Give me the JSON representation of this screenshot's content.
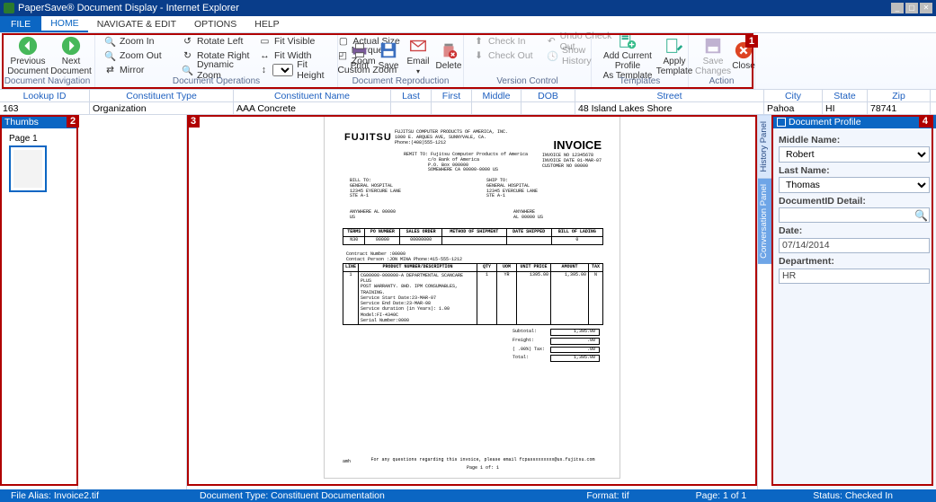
{
  "title": "PaperSave® Document Display - Internet Explorer",
  "tabs": {
    "file": "FILE",
    "home": "HOME",
    "navigate": "NAVIGATE & EDIT",
    "options": "OPTIONS",
    "help": "HELP"
  },
  "ribbon": {
    "navigation": {
      "label": "Document Navigation",
      "prev": "Previous\nDocument",
      "next": "Next Document"
    },
    "operations": {
      "label": "Document Operations",
      "zoom_in": "Zoom In",
      "zoom_out": "Zoom Out",
      "mirror": "Mirror",
      "rotate_left": "Rotate Left",
      "rotate_right": "Rotate Right",
      "dynamic_zoom": "Dynamic Zoom",
      "fit_visible": "Fit Visible",
      "fit_width": "Fit Width",
      "fit_height": "Fit Height",
      "actual_size": "Actual Size",
      "marquee_zoom": "Marquee Zoom",
      "custom_zoom": "Custom Zoom"
    },
    "reproduction": {
      "label": "Document Reproduction",
      "print": "Print",
      "save": "Save",
      "email": "Email",
      "delete": "Delete"
    },
    "version": {
      "label": "Version Control",
      "check_in": "Check In",
      "check_out": "Check Out",
      "undo_check_out": "Undo Check Out",
      "show_history": "Show History"
    },
    "templates": {
      "label": "Templates",
      "add_current": "Add Current Profile\nAs Template",
      "apply": "Apply\nTemplate"
    },
    "action": {
      "label": "Action",
      "save_changes": "Save\nChanges",
      "close": "Close"
    }
  },
  "callouts": {
    "c1": "1",
    "c2": "2",
    "c3": "3",
    "c4": "4"
  },
  "fields_header": {
    "lookup": "Lookup ID",
    "ctype": "Constituent Type",
    "cname": "Constituent Name",
    "last": "Last",
    "first": "First",
    "middle": "Middle",
    "dob": "DOB",
    "street": "Street",
    "city": "City",
    "state": "State",
    "zip": "Zip"
  },
  "fields_values": {
    "lookup": "163",
    "ctype": "Organization",
    "cname": "AAA Concrete",
    "last": "",
    "first": "",
    "middle": "",
    "dob": "",
    "street": "48 Island Lakes Shore",
    "city": "Pahoa",
    "state": "HI",
    "zip": "78741"
  },
  "thumbs": {
    "header": "Thumbs",
    "page1": "Page 1"
  },
  "doc": {
    "logo": "FUJITSU",
    "addr_l1": "FUJITSU COMPUTER PRODUCTS OF AMERICA, INC.",
    "addr_l2": "1000 E. ARQUES AVE, SUNNYVALE, CA.",
    "addr_l3": "Phone:(408)555-1212",
    "inv_title": "INVOICE",
    "inv_no_lbl": "INVOICE NO",
    "inv_no": "12345678",
    "inv_date_lbl": "INVOICE DATE",
    "inv_date": "01-MAR-07",
    "cust_no_lbl": "CUSTOMER NO",
    "cust_no": "00000",
    "remit_lbl": "REMIT TO:",
    "remit_l1": "Fujitsu Computer Products of America",
    "remit_l2": "c/o Bank of America",
    "remit_l3": "P.O. Box 000000",
    "remit_l4": "SOMEWHERE CA 00000-0000 US",
    "billto_lbl": "BILL TO:",
    "shipto_lbl": "SHIP TO:",
    "hosp": "GENERAL HOSPITAL",
    "addr_line": "12345 EYERCURE LANE",
    "ste": "STE A-1",
    "anywh_al": "ANYWHERE AL 00000",
    "us": "US",
    "anywh": "ANYWHERE",
    "al_us": "AL 00000 US",
    "t1": {
      "h_terms": "TERMS",
      "h_po": "PO NUMBER",
      "h_so": "SALES ORDER",
      "h_ship": "METHOD OF SHIPMENT",
      "h_date": "DATE SHIPPED",
      "h_bol": "BILL OF LADING",
      "v_terms": "N30",
      "v_po": "00000",
      "v_so": "00000000",
      "v_ship": "",
      "v_date": "",
      "v_bol": "0"
    },
    "contract_no": "Contract Number :00000",
    "contract_person": "Contact Person :JON MINA   Phone:415-555-1212",
    "t2": {
      "h_line": "LINE",
      "h_desc": "PRODUCT NUMBER/DESCRIPTION",
      "h_qty": "QTY",
      "h_uom": "UOM",
      "h_unit": "UNIT PRICE",
      "h_amt": "AMOUNT",
      "h_tax": "TAX",
      "line": "1",
      "desc": "CG00000-000000-A DEPARTMENTAL SCANCARE PLUS\nPOST WARRANTY. 8HD. IPM CONSUMABLES, TRAINING.\nService Start Date:23-MAR-07\nService End Date:23-MAR-08\nService duration (in Years): 1.00\nModel:FI-4340C\nSerial Number:0000",
      "qty": "1",
      "uom": "YR",
      "unit": "1395.00",
      "amt": "1,395.00",
      "tax": "N"
    },
    "tot": {
      "subtotal_lbl": "Subtotal:",
      "subtotal": "1,395.00",
      "freight_lbl": "Freight:",
      "freight": ".00",
      "tax_lbl": "Tax:",
      "tax_pct": "( .00%)",
      "tax": ".00",
      "total_lbl": "Total:",
      "total": "1,395.00"
    },
    "foot": "For any questions regarding this invoice, please email fcpassxxxxxxx@us.fujitsu.com",
    "page": "Page   1   of:   1",
    "sign": "amh"
  },
  "right_tabs": {
    "history": "History Panel",
    "conversation": "Conversation Panel"
  },
  "profile": {
    "header": "Document Profile",
    "middle_label": "Middle Name:",
    "middle_value": "Robert",
    "last_label": "Last Name:",
    "last_value": "Thomas",
    "docid_label": "DocumentID Detail:",
    "docid_value": "",
    "date_label": "Date:",
    "date_value": "07/14/2014",
    "dept_label": "Department:",
    "dept_value": "HR"
  },
  "status": {
    "file_alias": "File Alias: Invoice2.tif",
    "doc_type": "Document Type: Constituent Documentation",
    "format": "Format: tif",
    "page": "Page: 1 of 1",
    "status": "Status: Checked In"
  }
}
